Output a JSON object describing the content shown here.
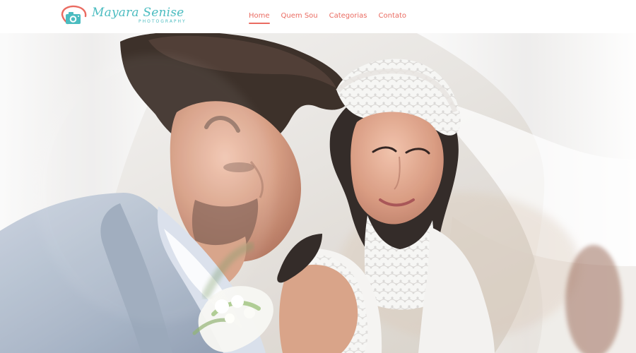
{
  "header": {
    "brand": {
      "name": "Mayara Senise",
      "subtitle": "PHOTOGRAPHY"
    },
    "nav": [
      {
        "label": "Home",
        "active": true
      },
      {
        "label": "Quem Sou",
        "active": false
      },
      {
        "label": "Categorias",
        "active": false
      },
      {
        "label": "Contato",
        "active": false
      }
    ]
  },
  "colors": {
    "accent": "#ea6b61",
    "brand_teal": "#4bbcc0"
  },
  "icons": {
    "logo": "camera-icon"
  }
}
